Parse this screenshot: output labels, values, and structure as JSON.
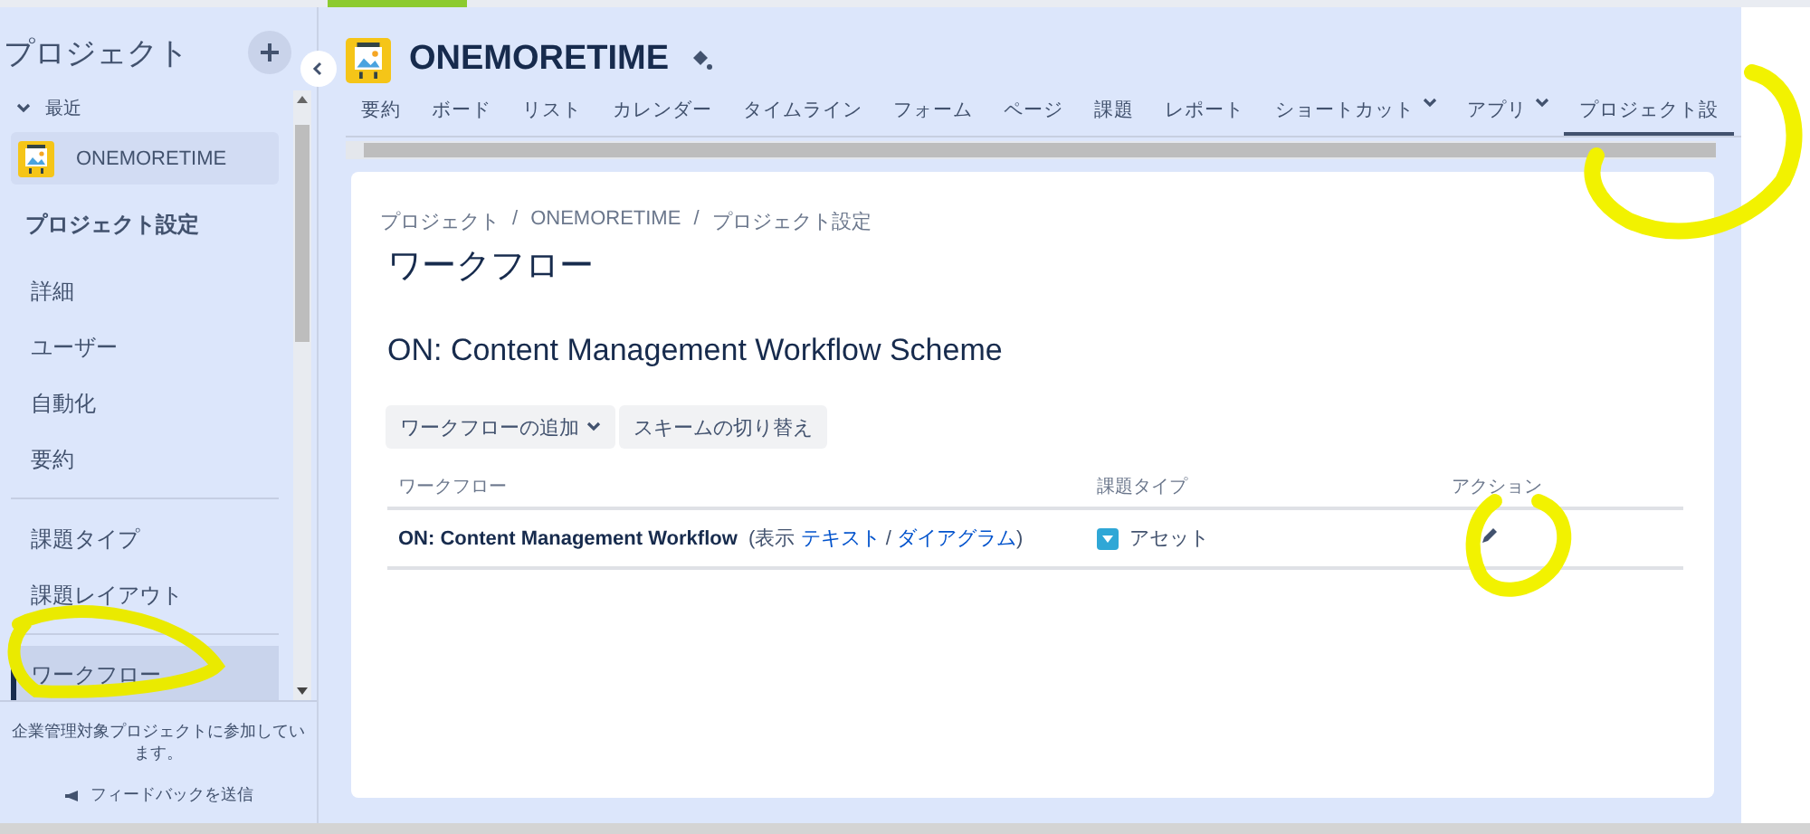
{
  "sidebar": {
    "title": "プロジェクト",
    "recent_label": "最近",
    "project": {
      "name": "ONEMORETIME"
    },
    "section_title": "プロジェクト設定",
    "groups": [
      {
        "items": [
          {
            "label": "詳細",
            "selected": false
          },
          {
            "label": "ユーザー",
            "selected": false
          },
          {
            "label": "自動化",
            "selected": false
          },
          {
            "label": "要約",
            "selected": false
          }
        ]
      },
      {
        "items": [
          {
            "label": "課題タイプ",
            "selected": false
          },
          {
            "label": "課題レイアウト",
            "selected": false
          }
        ]
      },
      {
        "items": [
          {
            "label": "ワークフロー",
            "selected": true
          }
        ]
      }
    ],
    "footer_note": "企業管理対象プロジェクトに参加しています。",
    "feedback": "フィードバックを送信"
  },
  "header": {
    "project_name": "ONEMORETIME"
  },
  "nav_tabs": [
    {
      "label": "要約",
      "selected": false,
      "has_menu": false
    },
    {
      "label": "ボード",
      "selected": false,
      "has_menu": false
    },
    {
      "label": "リスト",
      "selected": false,
      "has_menu": false
    },
    {
      "label": "カレンダー",
      "selected": false,
      "has_menu": false
    },
    {
      "label": "タイムライン",
      "selected": false,
      "has_menu": false
    },
    {
      "label": "フォーム",
      "selected": false,
      "has_menu": false
    },
    {
      "label": "ページ",
      "selected": false,
      "has_menu": false
    },
    {
      "label": "課題",
      "selected": false,
      "has_menu": false
    },
    {
      "label": "レポート",
      "selected": false,
      "has_menu": false
    },
    {
      "label": "ショートカット",
      "selected": false,
      "has_menu": true
    },
    {
      "label": "アプリ",
      "selected": false,
      "has_menu": true
    },
    {
      "label": "プロジェクト設",
      "selected": true,
      "has_menu": false
    }
  ],
  "breadcrumbs": {
    "items": [
      "プロジェクト",
      "ONEMORETIME",
      "プロジェクト設定"
    ],
    "separator": "/"
  },
  "page_title": "ワークフロー",
  "scheme_title": "ON: Content Management Workflow Scheme",
  "buttons": [
    {
      "label": "ワークフローの追加",
      "has_menu": true
    },
    {
      "label": "スキームの切り替え",
      "has_menu": false
    }
  ],
  "table": {
    "columns": [
      "ワークフロー",
      "課題タイプ",
      "アクション"
    ],
    "rows": [
      {
        "workflow": "ON: Content Management Workflow",
        "view_prefix": "(表示",
        "view_links": [
          "テキスト",
          "ダイアグラム"
        ],
        "view_separator": "/",
        "view_suffix": ")",
        "issue_type": "アセット"
      }
    ]
  }
}
